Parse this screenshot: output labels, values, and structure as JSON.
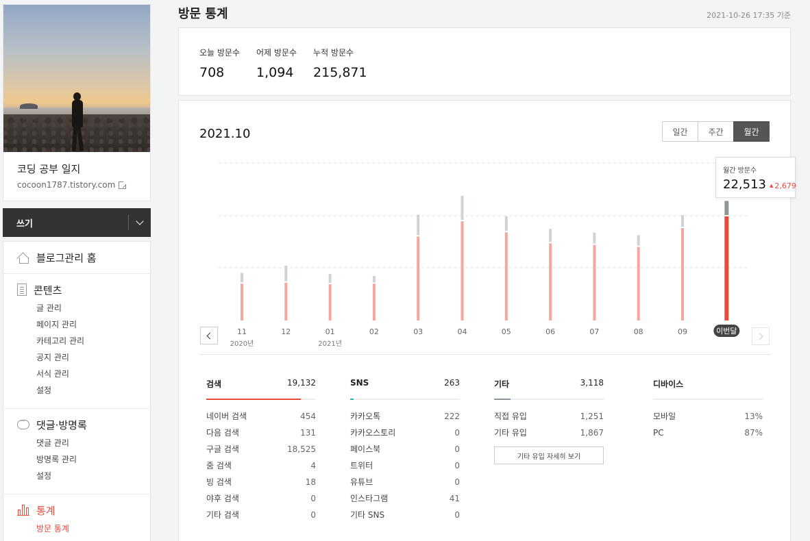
{
  "sidebar": {
    "blog_name": "코딩 공부 일지",
    "blog_url": "cocoon1787.tistory.com",
    "write_label": "쓰기",
    "menu": {
      "home": "블로그관리 홈",
      "contents": {
        "title": "콘텐츠",
        "items": [
          "글 관리",
          "페이지 관리",
          "카테고리 관리",
          "공지 관리",
          "서식 관리",
          "설정"
        ]
      },
      "comments": {
        "title": "댓글·방명록",
        "items": [
          "댓글 관리",
          "방명록 관리",
          "설정"
        ]
      },
      "stats": {
        "title": "통계",
        "items": [
          "방문 통계"
        ]
      }
    }
  },
  "header": {
    "title": "방문 통계",
    "as_of": "2021-10-26 17:35 기준"
  },
  "summary": {
    "today_label": "오늘 방문수",
    "today_value": "708",
    "yesterday_label": "어제 방문수",
    "yesterday_value": "1,094",
    "total_label": "누적 방문수",
    "total_value": "215,871"
  },
  "chart_section": {
    "period": "2021.10",
    "tabs": [
      {
        "label": "일간",
        "active": false
      },
      {
        "label": "주간",
        "active": false
      },
      {
        "label": "월간",
        "active": true
      }
    ],
    "tooltip": {
      "label": "월간 방문수",
      "value": "22,513",
      "diff": "2,679"
    }
  },
  "chart_data": {
    "type": "bar",
    "categories": [
      "11",
      "12",
      "01",
      "02",
      "03",
      "04",
      "05",
      "06",
      "07",
      "08",
      "09",
      "이번달"
    ],
    "year_labels": [
      {
        "index": 0,
        "label": "2020년"
      },
      {
        "index": 2,
        "label": "2021년"
      }
    ],
    "series": [
      {
        "values": [
          7000,
          7200,
          6900,
          7000,
          16000,
          18900,
          16800,
          14700,
          14400,
          14000,
          17600,
          19834
        ]
      },
      {
        "values": [
          1800,
          3000,
          1700,
          1200,
          3900,
          4600,
          2800,
          2500,
          2100,
          2000,
          2200,
          2679
        ]
      }
    ],
    "totals": [
      8800,
      10200,
      8600,
      8200,
      19900,
      23500,
      19600,
      17200,
      16500,
      16000,
      19800,
      22513
    ],
    "ylim": [
      0,
      30000
    ],
    "grid": true,
    "colors": {
      "primary": "#f4a7a0",
      "secondary": "#cfd3d6",
      "highlight": "#e84a3b",
      "highlight_top": "#8f9699"
    }
  },
  "breakdown": {
    "search": {
      "title": "검색",
      "total": "19,132",
      "fill": 0.86,
      "color": "#e84a3b",
      "rows": [
        {
          "name": "네이버 검색",
          "value": "454"
        },
        {
          "name": "다음 검색",
          "value": "131"
        },
        {
          "name": "구글 검색",
          "value": "18,525"
        },
        {
          "name": "줌 검색",
          "value": "4"
        },
        {
          "name": "빙 검색",
          "value": "18"
        },
        {
          "name": "야후 검색",
          "value": "0"
        },
        {
          "name": "기타 검색",
          "value": "0"
        }
      ]
    },
    "sns": {
      "title": "SNS",
      "total": "263",
      "fill": 0.03,
      "color": "#1bbc9b",
      "rows": [
        {
          "name": "카카오톡",
          "value": "222"
        },
        {
          "name": "카카오스토리",
          "value": "0"
        },
        {
          "name": "페이스북",
          "value": "0"
        },
        {
          "name": "트위터",
          "value": "0"
        },
        {
          "name": "유튜브",
          "value": "0"
        },
        {
          "name": "인스타그램",
          "value": "41"
        },
        {
          "name": "기타 SNS",
          "value": "0"
        }
      ]
    },
    "etc": {
      "title": "기타",
      "total": "3,118",
      "fill": 0.15,
      "color": "#8f9699",
      "rows": [
        {
          "name": "직접 유입",
          "value": "1,251"
        },
        {
          "name": "기타 유입",
          "value": "1,867"
        }
      ],
      "detail_button": "기타 유입 자세히 보기"
    },
    "device": {
      "title": "디바이스",
      "rows": [
        {
          "name": "모바일",
          "value": "13%"
        },
        {
          "name": "PC",
          "value": "87%"
        }
      ]
    }
  }
}
